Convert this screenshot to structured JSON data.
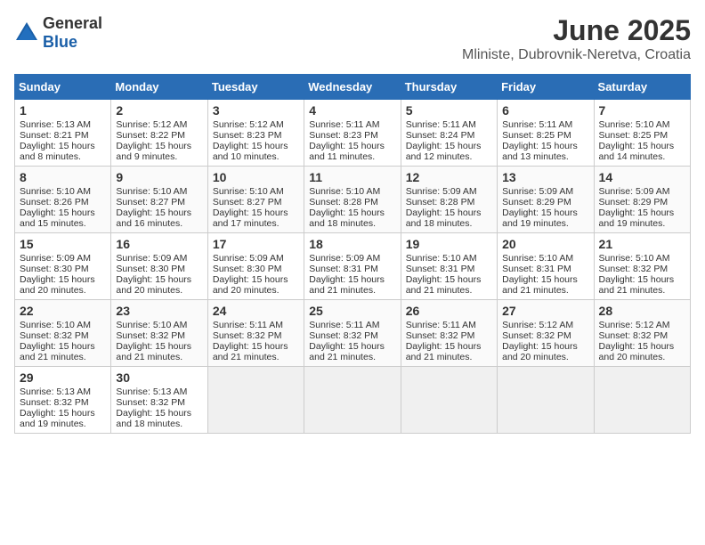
{
  "header": {
    "logo_general": "General",
    "logo_blue": "Blue",
    "title": "June 2025",
    "subtitle": "Mliniste, Dubrovnik-Neretva, Croatia"
  },
  "calendar": {
    "days_of_week": [
      "Sunday",
      "Monday",
      "Tuesday",
      "Wednesday",
      "Thursday",
      "Friday",
      "Saturday"
    ],
    "weeks": [
      [
        {
          "day": "",
          "sunrise": "",
          "sunset": "",
          "daylight": "",
          "empty": true
        },
        {
          "day": "2",
          "sunrise": "Sunrise: 5:12 AM",
          "sunset": "Sunset: 8:22 PM",
          "daylight": "Daylight: 15 hours and 9 minutes."
        },
        {
          "day": "3",
          "sunrise": "Sunrise: 5:12 AM",
          "sunset": "Sunset: 8:23 PM",
          "daylight": "Daylight: 15 hours and 10 minutes."
        },
        {
          "day": "4",
          "sunrise": "Sunrise: 5:11 AM",
          "sunset": "Sunset: 8:23 PM",
          "daylight": "Daylight: 15 hours and 11 minutes."
        },
        {
          "day": "5",
          "sunrise": "Sunrise: 5:11 AM",
          "sunset": "Sunset: 8:24 PM",
          "daylight": "Daylight: 15 hours and 12 minutes."
        },
        {
          "day": "6",
          "sunrise": "Sunrise: 5:11 AM",
          "sunset": "Sunset: 8:25 PM",
          "daylight": "Daylight: 15 hours and 13 minutes."
        },
        {
          "day": "7",
          "sunrise": "Sunrise: 5:10 AM",
          "sunset": "Sunset: 8:25 PM",
          "daylight": "Daylight: 15 hours and 14 minutes."
        }
      ],
      [
        {
          "day": "1",
          "sunrise": "Sunrise: 5:13 AM",
          "sunset": "Sunset: 8:21 PM",
          "daylight": "Daylight: 15 hours and 8 minutes."
        },
        {
          "day": "8",
          "sunrise": "Sunrise: 5:10 AM",
          "sunset": "Sunset: 8:26 PM",
          "daylight": "Daylight: 15 hours and 15 minutes."
        },
        {
          "day": "9",
          "sunrise": "Sunrise: 5:10 AM",
          "sunset": "Sunset: 8:27 PM",
          "daylight": "Daylight: 15 hours and 16 minutes."
        },
        {
          "day": "10",
          "sunrise": "Sunrise: 5:10 AM",
          "sunset": "Sunset: 8:27 PM",
          "daylight": "Daylight: 15 hours and 17 minutes."
        },
        {
          "day": "11",
          "sunrise": "Sunrise: 5:10 AM",
          "sunset": "Sunset: 8:28 PM",
          "daylight": "Daylight: 15 hours and 18 minutes."
        },
        {
          "day": "12",
          "sunrise": "Sunrise: 5:09 AM",
          "sunset": "Sunset: 8:28 PM",
          "daylight": "Daylight: 15 hours and 18 minutes."
        },
        {
          "day": "13",
          "sunrise": "Sunrise: 5:09 AM",
          "sunset": "Sunset: 8:29 PM",
          "daylight": "Daylight: 15 hours and 19 minutes."
        },
        {
          "day": "14",
          "sunrise": "Sunrise: 5:09 AM",
          "sunset": "Sunset: 8:29 PM",
          "daylight": "Daylight: 15 hours and 19 minutes."
        }
      ],
      [
        {
          "day": "15",
          "sunrise": "Sunrise: 5:09 AM",
          "sunset": "Sunset: 8:30 PM",
          "daylight": "Daylight: 15 hours and 20 minutes."
        },
        {
          "day": "16",
          "sunrise": "Sunrise: 5:09 AM",
          "sunset": "Sunset: 8:30 PM",
          "daylight": "Daylight: 15 hours and 20 minutes."
        },
        {
          "day": "17",
          "sunrise": "Sunrise: 5:09 AM",
          "sunset": "Sunset: 8:30 PM",
          "daylight": "Daylight: 15 hours and 20 minutes."
        },
        {
          "day": "18",
          "sunrise": "Sunrise: 5:09 AM",
          "sunset": "Sunset: 8:31 PM",
          "daylight": "Daylight: 15 hours and 21 minutes."
        },
        {
          "day": "19",
          "sunrise": "Sunrise: 5:10 AM",
          "sunset": "Sunset: 8:31 PM",
          "daylight": "Daylight: 15 hours and 21 minutes."
        },
        {
          "day": "20",
          "sunrise": "Sunrise: 5:10 AM",
          "sunset": "Sunset: 8:31 PM",
          "daylight": "Daylight: 15 hours and 21 minutes."
        },
        {
          "day": "21",
          "sunrise": "Sunrise: 5:10 AM",
          "sunset": "Sunset: 8:32 PM",
          "daylight": "Daylight: 15 hours and 21 minutes."
        }
      ],
      [
        {
          "day": "22",
          "sunrise": "Sunrise: 5:10 AM",
          "sunset": "Sunset: 8:32 PM",
          "daylight": "Daylight: 15 hours and 21 minutes."
        },
        {
          "day": "23",
          "sunrise": "Sunrise: 5:10 AM",
          "sunset": "Sunset: 8:32 PM",
          "daylight": "Daylight: 15 hours and 21 minutes."
        },
        {
          "day": "24",
          "sunrise": "Sunrise: 5:11 AM",
          "sunset": "Sunset: 8:32 PM",
          "daylight": "Daylight: 15 hours and 21 minutes."
        },
        {
          "day": "25",
          "sunrise": "Sunrise: 5:11 AM",
          "sunset": "Sunset: 8:32 PM",
          "daylight": "Daylight: 15 hours and 21 minutes."
        },
        {
          "day": "26",
          "sunrise": "Sunrise: 5:11 AM",
          "sunset": "Sunset: 8:32 PM",
          "daylight": "Daylight: 15 hours and 21 minutes."
        },
        {
          "day": "27",
          "sunrise": "Sunrise: 5:12 AM",
          "sunset": "Sunset: 8:32 PM",
          "daylight": "Daylight: 15 hours and 20 minutes."
        },
        {
          "day": "28",
          "sunrise": "Sunrise: 5:12 AM",
          "sunset": "Sunset: 8:32 PM",
          "daylight": "Daylight: 15 hours and 20 minutes."
        }
      ],
      [
        {
          "day": "29",
          "sunrise": "Sunrise: 5:13 AM",
          "sunset": "Sunset: 8:32 PM",
          "daylight": "Daylight: 15 hours and 19 minutes."
        },
        {
          "day": "30",
          "sunrise": "Sunrise: 5:13 AM",
          "sunset": "Sunset: 8:32 PM",
          "daylight": "Daylight: 15 hours and 18 minutes."
        },
        {
          "day": "",
          "sunrise": "",
          "sunset": "",
          "daylight": "",
          "empty": true
        },
        {
          "day": "",
          "sunrise": "",
          "sunset": "",
          "daylight": "",
          "empty": true
        },
        {
          "day": "",
          "sunrise": "",
          "sunset": "",
          "daylight": "",
          "empty": true
        },
        {
          "day": "",
          "sunrise": "",
          "sunset": "",
          "daylight": "",
          "empty": true
        },
        {
          "day": "",
          "sunrise": "",
          "sunset": "",
          "daylight": "",
          "empty": true
        }
      ]
    ]
  }
}
